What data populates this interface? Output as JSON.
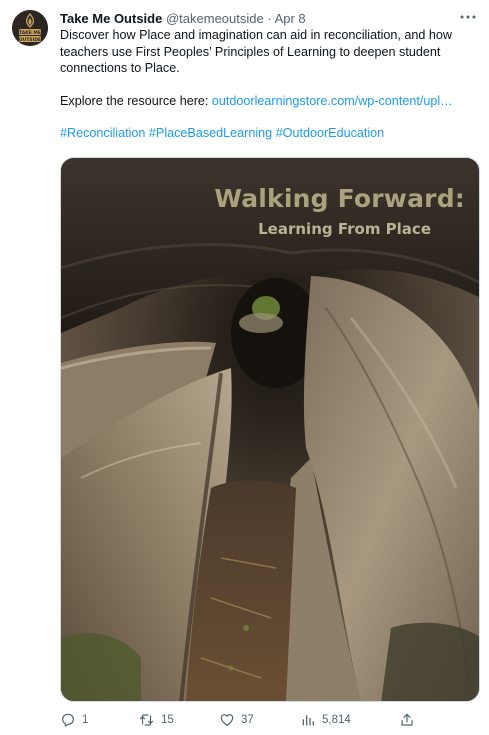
{
  "tweet": {
    "author_name": "Take Me Outside",
    "handle": "@takemeoutside",
    "separator": "·",
    "date": "Apr 8",
    "avatar_text_top": "TAKE ME",
    "avatar_text_bottom": "OUTSIDE",
    "text_line1": "Discover how Place and imagination can aid in reconciliation, and how teachers use First Peoples’ Principles of Learning to deepen student connections to Place.",
    "explore_prefix": "Explore the resource here: ",
    "link_text": "outdoorlearningstore.com/wp-content/upl…",
    "hashtags": [
      "#Reconciliation",
      "#PlaceBasedLearning",
      "#OutdoorEducation"
    ]
  },
  "media": {
    "title": "Walking Forward:",
    "subtitle": "Learning From Place"
  },
  "actions": {
    "replies": "1",
    "reposts": "15",
    "likes": "37",
    "views": "5,814"
  },
  "colors": {
    "link": "#1d9bf0",
    "muted": "#536471",
    "text": "#0f1419",
    "title_text": "#a9a27c"
  },
  "icons": {
    "reply": "reply-icon",
    "repost": "repost-icon",
    "like": "heart-icon",
    "views": "views-chart-icon",
    "share": "share-icon",
    "more": "more-dots-icon"
  }
}
